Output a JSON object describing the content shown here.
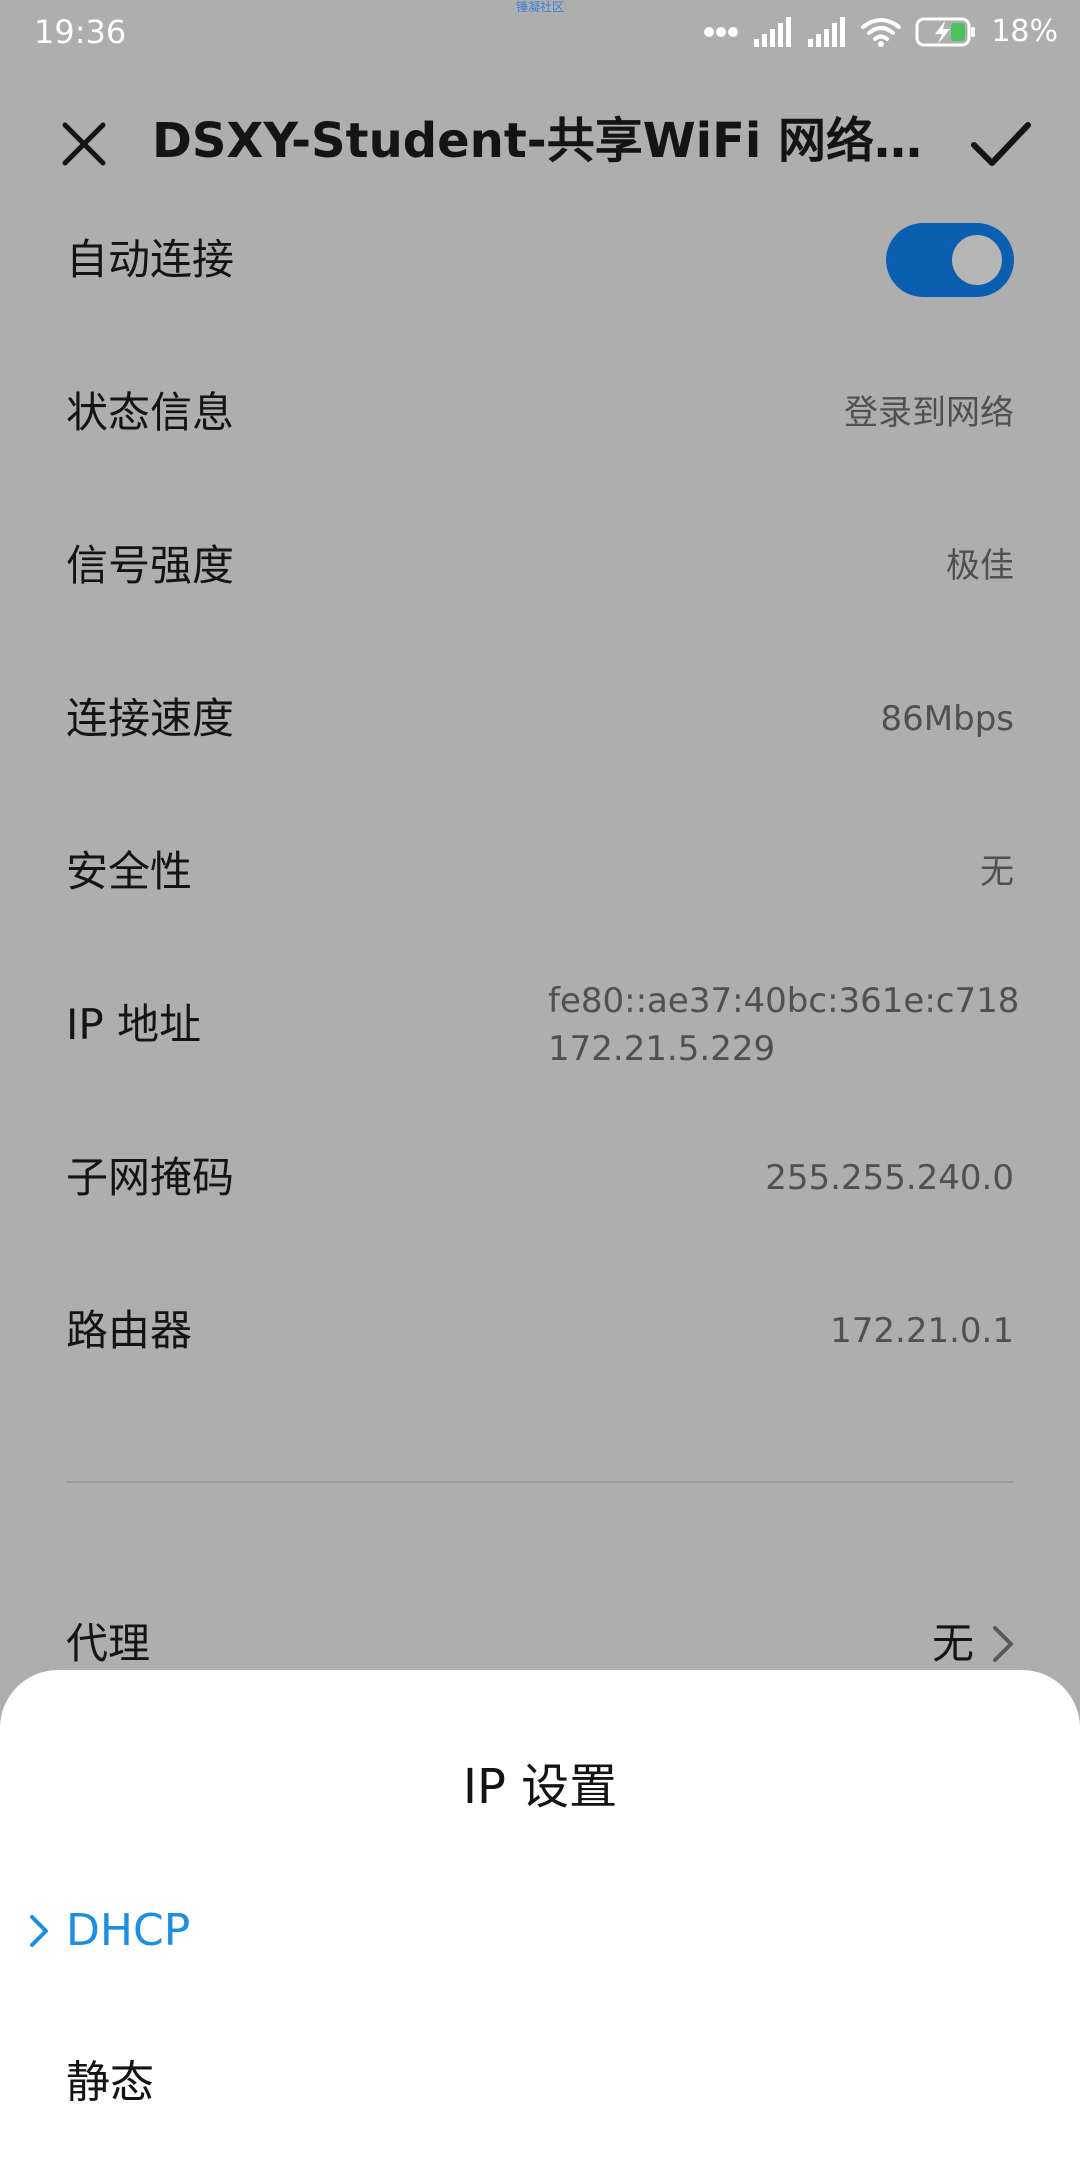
{
  "status_bar": {
    "time": "19:36",
    "watermark": "锤凝社区",
    "battery_percent": "18%",
    "icons": [
      "more-dots-icon",
      "signal-1-icon",
      "signal-2-icon",
      "wifi-icon",
      "battery-charging-icon"
    ]
  },
  "header": {
    "title": "DSXY-Student-共享WiFi 网络详情",
    "close_icon": "close-icon",
    "confirm_icon": "check-icon"
  },
  "details": {
    "auto_connect_label": "自动连接",
    "auto_connect_on": true,
    "status": {
      "label": "状态信息",
      "value": "登录到网络"
    },
    "signal": {
      "label": "信号强度",
      "value": "极佳"
    },
    "speed": {
      "label": "连接速度",
      "value": "86Mbps"
    },
    "security": {
      "label": "安全性",
      "value": "无"
    },
    "ip": {
      "label": "IP 地址",
      "value_v6": "fe80::ae37:40bc:361e:c718",
      "value_v4": "172.21.5.229"
    },
    "subnet": {
      "label": "子网掩码",
      "value": "255.255.240.0"
    },
    "router": {
      "label": "路由器",
      "value": "172.21.0.1"
    },
    "proxy": {
      "label": "代理",
      "value": "无"
    }
  },
  "sheet": {
    "title": "IP 设置",
    "options": [
      {
        "label": "DHCP",
        "selected": true
      },
      {
        "label": "静态",
        "selected": false
      }
    ],
    "accent_color": "#1a8fe3"
  },
  "colors": {
    "dim_background": "#aeaeae",
    "toggle_on": "#0a5fb0"
  }
}
